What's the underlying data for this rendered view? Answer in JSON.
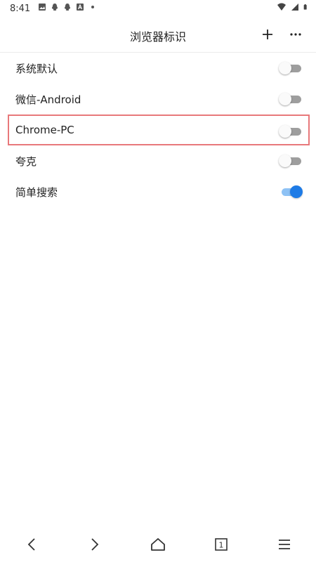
{
  "status_bar": {
    "time": "8:41",
    "left_icons": [
      "image-icon",
      "qq-icon",
      "qq-icon",
      "app-icon",
      "dot-icon"
    ],
    "right_icons": [
      "wifi-icon",
      "signal-icon",
      "battery-icon"
    ]
  },
  "header": {
    "title": "浏览器标识",
    "add_icon": "plus-icon",
    "more_icon": "ellipsis-icon"
  },
  "user_agents": [
    {
      "label": "系统默认",
      "enabled": false,
      "highlighted": false
    },
    {
      "label": "微信-Android",
      "enabled": false,
      "highlighted": false
    },
    {
      "label": "Chrome-PC",
      "enabled": false,
      "highlighted": true
    },
    {
      "label": "夸克",
      "enabled": false,
      "highlighted": false
    },
    {
      "label": "简单搜索",
      "enabled": true,
      "highlighted": false
    }
  ],
  "bottom_nav": {
    "items": [
      "back-icon",
      "forward-icon",
      "home-icon",
      "tabs-icon",
      "menu-icon"
    ],
    "tab_count": "1"
  },
  "colors": {
    "accent": "#1e7be6",
    "highlight_border": "#e8787b"
  }
}
